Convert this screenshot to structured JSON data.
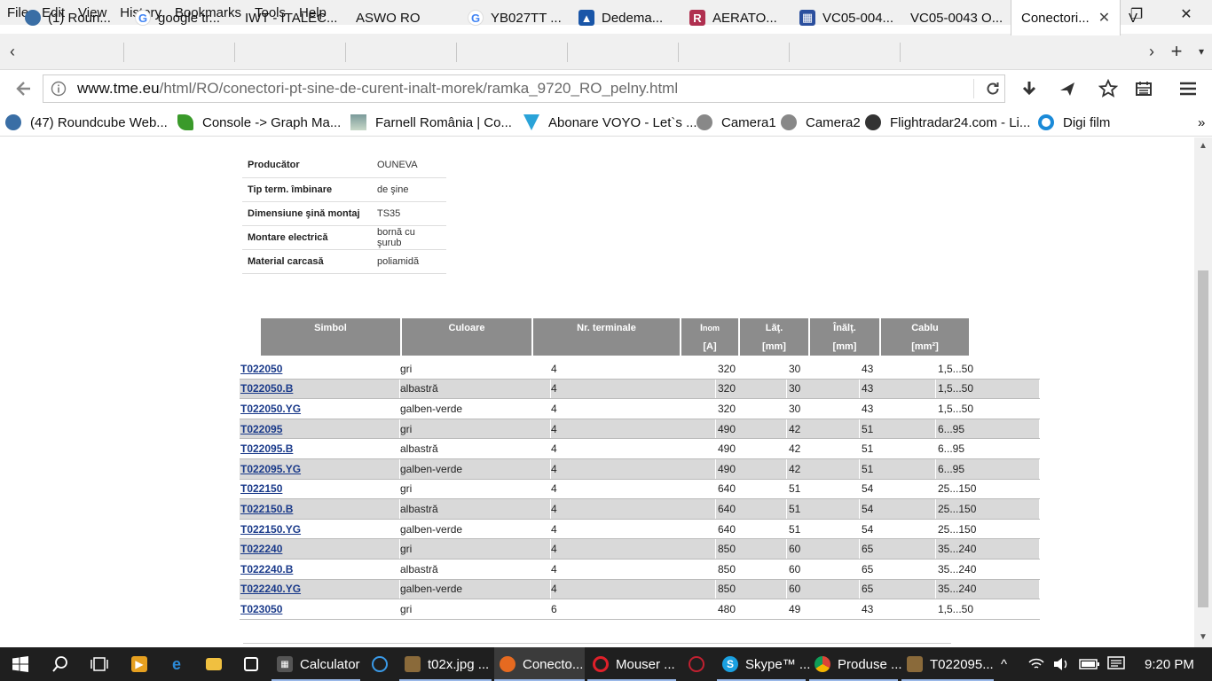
{
  "menu": [
    "File",
    "Edit",
    "View",
    "History",
    "Bookmarks",
    "Tools",
    "Help"
  ],
  "window_controls": {
    "minimize": "—",
    "restore": "❐",
    "close": "✕"
  },
  "tabs": [
    {
      "label": "(1) Roun...",
      "icon": "roundcube-icon",
      "color": "#3a6ea5"
    },
    {
      "label": "google tr...",
      "icon": "google-icon",
      "color": "#4285f4"
    },
    {
      "label": "IWT - ITALEC...",
      "icon": "",
      "color": ""
    },
    {
      "label": "ASWO RO",
      "icon": "",
      "color": ""
    },
    {
      "label": "YB027TT ...",
      "icon": "google-icon",
      "color": "#4285f4"
    },
    {
      "label": "Dedema...",
      "icon": "dedeman-icon",
      "color": "#1a56a8"
    },
    {
      "label": "AERATO...",
      "icon": "aerato-icon",
      "color": "#b03050"
    },
    {
      "label": "VC05-004...",
      "icon": "vc-icon",
      "color": "#2b4f9e"
    },
    {
      "label": "VC05-0043 O...",
      "icon": "",
      "color": ""
    },
    {
      "label": "Conectori...",
      "icon": "",
      "color": ""
    },
    {
      "label": "V",
      "icon": "",
      "color": ""
    }
  ],
  "tab_close": "✕",
  "new_tab": "+",
  "address": {
    "domain": "www.tme.eu",
    "path": "/html/RO/conectori-pt-sine-de-curent-inalt-morek/ramka_9720_RO_pelny.html"
  },
  "bookmarks": [
    {
      "label": "(47) Roundcube Web...",
      "icon": "roundcube-icon",
      "color": "#3a6ea5"
    },
    {
      "label": "Console -> Graph Ma...",
      "icon": "leaf-icon",
      "color": "#3a9a2a"
    },
    {
      "label": "Farnell România | Co...",
      "icon": "farnell-icon",
      "color": "#7a9a9a"
    },
    {
      "label": "Abonare VOYO - Let`s ...",
      "icon": "voyo-icon",
      "color": "#2aa3d8"
    },
    {
      "label": "Camera1",
      "icon": "camera-icon",
      "color": "#888888"
    },
    {
      "label": "Camera2",
      "icon": "camera-icon",
      "color": "#888888"
    },
    {
      "label": "Flightradar24.com - Li...",
      "icon": "radar-icon",
      "color": "#333333"
    },
    {
      "label": "Digi film",
      "icon": "digi-icon",
      "color": "#1a8ad8"
    }
  ],
  "bookmarks_overflow": "»",
  "specs": [
    {
      "key": "Producător",
      "value": "OUNEVA"
    },
    {
      "key": "Tip term. îmbinare",
      "value": "de şine"
    },
    {
      "key": "Dimensiune şină montaj",
      "value": "TS35"
    },
    {
      "key": "Montare electrică",
      "value": "bornă cu şurub"
    },
    {
      "key": "Material carcasă",
      "value": "poliamidă"
    }
  ],
  "table_header": {
    "simbol": "Simbol",
    "culoare": "Culoare",
    "terminale": "Nr. terminale",
    "inom": "I",
    "inom_sub": "nom",
    "lat": "Lăţ.",
    "inalt": "Înălţ.",
    "cablu": "Cablu",
    "u_inom": "[A]",
    "u_lat": "[mm]",
    "u_inalt": "[mm]",
    "u_cablu": "[mm²]"
  },
  "rows": [
    [
      "T022050",
      "gri",
      "4",
      "320",
      "30",
      "43",
      "1,5...50"
    ],
    [
      "T022050.B",
      "albastră",
      "4",
      "320",
      "30",
      "43",
      "1,5...50"
    ],
    [
      "T022050.YG",
      "galben-verde",
      "4",
      "320",
      "30",
      "43",
      "1,5...50"
    ],
    [
      "T022095",
      "gri",
      "4",
      "490",
      "42",
      "51",
      "6...95"
    ],
    [
      "T022095.B",
      "albastră",
      "4",
      "490",
      "42",
      "51",
      "6...95"
    ],
    [
      "T022095.YG",
      "galben-verde",
      "4",
      "490",
      "42",
      "51",
      "6...95"
    ],
    [
      "T022150",
      "gri",
      "4",
      "640",
      "51",
      "54",
      "25...150"
    ],
    [
      "T022150.B",
      "albastră",
      "4",
      "640",
      "51",
      "54",
      "25...150"
    ],
    [
      "T022150.YG",
      "galben-verde",
      "4",
      "640",
      "51",
      "54",
      "25...150"
    ],
    [
      "T022240",
      "gri",
      "4",
      "850",
      "60",
      "65",
      "35...240"
    ],
    [
      "T022240.B",
      "albastră",
      "4",
      "850",
      "60",
      "65",
      "35...240"
    ],
    [
      "T022240.YG",
      "galben-verde",
      "4",
      "850",
      "60",
      "65",
      "35...240"
    ],
    [
      "T023050",
      "gri",
      "6",
      "480",
      "49",
      "43",
      "1,5...50"
    ]
  ],
  "taskbar": [
    {
      "label": "Calculator",
      "icon": "calculator-icon"
    },
    {
      "label": "t02x.jpg ...",
      "icon": "image-viewer-icon"
    },
    {
      "label": "Conecto...",
      "icon": "firefox-icon"
    },
    {
      "label": "Mouser ...",
      "icon": "opera-icon"
    },
    {
      "label": "Skype™ ...",
      "icon": "skype-icon"
    },
    {
      "label": "Produse ...",
      "icon": "chrome-icon"
    },
    {
      "label": "T022095...",
      "icon": "image-viewer-icon"
    }
  ],
  "clock": "9:20 PM"
}
